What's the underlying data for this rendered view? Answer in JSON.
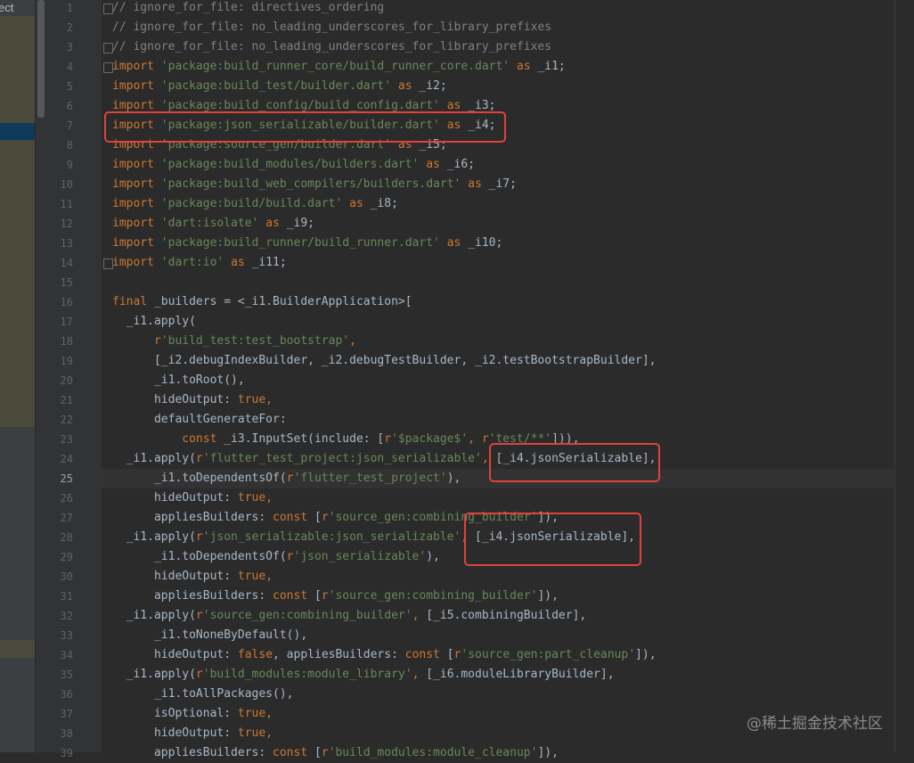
{
  "project_panel": {
    "label": "ect"
  },
  "editor": {
    "current_line": 25,
    "lines": [
      {
        "n": "1",
        "tokens": [
          {
            "t": "// ignore_for_file: directives_ordering",
            "c": "com"
          }
        ]
      },
      {
        "n": "2",
        "tokens": [
          {
            "t": "// ignore_for_file: no_leading_underscores_for_library_prefixes",
            "c": "com"
          }
        ]
      },
      {
        "n": "3",
        "tokens": [
          {
            "t": "// ignore_for_file: no_leading_underscores_for_library_prefixes",
            "c": "com"
          }
        ]
      },
      {
        "n": "4",
        "tokens": [
          {
            "t": "import ",
            "c": "kw"
          },
          {
            "t": "'package:build_runner_core/build_runner_core.dart'",
            "c": "str"
          },
          {
            "t": " as ",
            "c": "kw"
          },
          {
            "t": "_i1;",
            "c": "id"
          }
        ]
      },
      {
        "n": "5",
        "tokens": [
          {
            "t": "import ",
            "c": "kw"
          },
          {
            "t": "'package:build_test/builder.dart'",
            "c": "str"
          },
          {
            "t": " as ",
            "c": "kw"
          },
          {
            "t": "_i2;",
            "c": "id"
          }
        ]
      },
      {
        "n": "6",
        "tokens": [
          {
            "t": "import ",
            "c": "kw"
          },
          {
            "t": "'package:build_config/build_config.dart'",
            "c": "str"
          },
          {
            "t": " as ",
            "c": "kw"
          },
          {
            "t": "_i3;",
            "c": "id"
          }
        ]
      },
      {
        "n": "7",
        "tokens": [
          {
            "t": "import ",
            "c": "kw"
          },
          {
            "t": "'package:json_serializable/builder.dart'",
            "c": "str"
          },
          {
            "t": " as ",
            "c": "kw"
          },
          {
            "t": "_i4;",
            "c": "id"
          }
        ]
      },
      {
        "n": "8",
        "tokens": [
          {
            "t": "import ",
            "c": "kw"
          },
          {
            "t": "'package:source_gen/builder.dart'",
            "c": "str"
          },
          {
            "t": " as ",
            "c": "kw"
          },
          {
            "t": "_i5;",
            "c": "id"
          }
        ]
      },
      {
        "n": "9",
        "tokens": [
          {
            "t": "import ",
            "c": "kw"
          },
          {
            "t": "'package:build_modules/builders.dart'",
            "c": "str"
          },
          {
            "t": " as ",
            "c": "kw"
          },
          {
            "t": "_i6;",
            "c": "id"
          }
        ]
      },
      {
        "n": "10",
        "tokens": [
          {
            "t": "import ",
            "c": "kw"
          },
          {
            "t": "'package:build_web_compilers/builders.dart'",
            "c": "str"
          },
          {
            "t": " as ",
            "c": "kw"
          },
          {
            "t": "_i7;",
            "c": "id"
          }
        ]
      },
      {
        "n": "11",
        "tokens": [
          {
            "t": "import ",
            "c": "kw"
          },
          {
            "t": "'package:build/build.dart'",
            "c": "str"
          },
          {
            "t": " as ",
            "c": "kw"
          },
          {
            "t": "_i8;",
            "c": "id"
          }
        ]
      },
      {
        "n": "12",
        "tokens": [
          {
            "t": "import ",
            "c": "kw"
          },
          {
            "t": "'dart:isolate'",
            "c": "str"
          },
          {
            "t": " as ",
            "c": "kw"
          },
          {
            "t": "_i9;",
            "c": "id"
          }
        ]
      },
      {
        "n": "13",
        "tokens": [
          {
            "t": "import ",
            "c": "kw"
          },
          {
            "t": "'package:build_runner/build_runner.dart'",
            "c": "str"
          },
          {
            "t": " as ",
            "c": "kw"
          },
          {
            "t": "_i10;",
            "c": "id"
          }
        ]
      },
      {
        "n": "14",
        "tokens": [
          {
            "t": "import ",
            "c": "kw"
          },
          {
            "t": "'dart:io'",
            "c": "str"
          },
          {
            "t": " as ",
            "c": "kw"
          },
          {
            "t": "_i11;",
            "c": "id"
          }
        ]
      },
      {
        "n": "15",
        "tokens": []
      },
      {
        "n": "16",
        "tokens": [
          {
            "t": "final ",
            "c": "kw"
          },
          {
            "t": "_builders = <_i1.BuilderApplication>[",
            "c": "id"
          }
        ]
      },
      {
        "n": "17",
        "tokens": [
          {
            "t": "  _i1.apply(",
            "c": "id"
          }
        ]
      },
      {
        "n": "18",
        "tokens": [
          {
            "t": "      r",
            "c": "kw"
          },
          {
            "t": "'build_test:test_bootstrap'",
            "c": "str"
          },
          {
            "t": ",",
            "c": "kw"
          }
        ]
      },
      {
        "n": "19",
        "tokens": [
          {
            "t": "      [_i2.debugIndexBuilder, _i2.debugTestBuilder, _i2.testBootstrapBuilder],",
            "c": "id"
          }
        ]
      },
      {
        "n": "20",
        "tokens": [
          {
            "t": "      _i1.toRoot(),",
            "c": "id"
          }
        ]
      },
      {
        "n": "21",
        "tokens": [
          {
            "t": "      hideOutput: ",
            "c": "id"
          },
          {
            "t": "true",
            "c": "kw"
          },
          {
            "t": ",",
            "c": "kw"
          }
        ]
      },
      {
        "n": "22",
        "tokens": [
          {
            "t": "      defaultGenerateFor:",
            "c": "id"
          }
        ]
      },
      {
        "n": "23",
        "tokens": [
          {
            "t": "          const ",
            "c": "kw"
          },
          {
            "t": "_i3.InputSet(include: [",
            "c": "id"
          },
          {
            "t": "r",
            "c": "kw"
          },
          {
            "t": "'$package$'",
            "c": "str"
          },
          {
            "t": ", ",
            "c": "kw"
          },
          {
            "t": "r",
            "c": "kw"
          },
          {
            "t": "'test/**'",
            "c": "str"
          },
          {
            "t": "])),",
            "c": "id"
          }
        ]
      },
      {
        "n": "24",
        "tokens": [
          {
            "t": "  _i1.apply(",
            "c": "id"
          },
          {
            "t": "r",
            "c": "kw"
          },
          {
            "t": "'flutter_test_project:json_serializable'",
            "c": "str"
          },
          {
            "t": ", ",
            "c": "kw"
          },
          {
            "t": "[_i4.jsonSerializable],",
            "c": "id"
          }
        ]
      },
      {
        "n": "25",
        "tokens": [
          {
            "t": "      _i1.toDependentsOf(",
            "c": "id"
          },
          {
            "t": "r",
            "c": "kw"
          },
          {
            "t": "'flutter_test_project'",
            "c": "str"
          },
          {
            "t": "),",
            "c": "id"
          }
        ]
      },
      {
        "n": "26",
        "tokens": [
          {
            "t": "      hideOutput: ",
            "c": "id"
          },
          {
            "t": "true",
            "c": "kw"
          },
          {
            "t": ",",
            "c": "kw"
          }
        ]
      },
      {
        "n": "27",
        "tokens": [
          {
            "t": "      appliesBuilders: ",
            "c": "id"
          },
          {
            "t": "const ",
            "c": "kw"
          },
          {
            "t": "[",
            "c": "id"
          },
          {
            "t": "r",
            "c": "kw"
          },
          {
            "t": "'source_gen:combining_builder'",
            "c": "str"
          },
          {
            "t": "]),",
            "c": "id"
          }
        ]
      },
      {
        "n": "28",
        "tokens": [
          {
            "t": "  _i1.apply(",
            "c": "id"
          },
          {
            "t": "r",
            "c": "kw"
          },
          {
            "t": "'json_serializable:json_serializable'",
            "c": "str"
          },
          {
            "t": ", ",
            "c": "kw"
          },
          {
            "t": "[_i4.jsonSerializable],",
            "c": "id"
          }
        ]
      },
      {
        "n": "29",
        "tokens": [
          {
            "t": "      _i1.toDependentsOf(",
            "c": "id"
          },
          {
            "t": "r",
            "c": "kw"
          },
          {
            "t": "'json_serializable'",
            "c": "str"
          },
          {
            "t": "),",
            "c": "id"
          }
        ]
      },
      {
        "n": "30",
        "tokens": [
          {
            "t": "      hideOutput: ",
            "c": "id"
          },
          {
            "t": "true",
            "c": "kw"
          },
          {
            "t": ",",
            "c": "kw"
          }
        ]
      },
      {
        "n": "31",
        "tokens": [
          {
            "t": "      appliesBuilders: ",
            "c": "id"
          },
          {
            "t": "const ",
            "c": "kw"
          },
          {
            "t": "[",
            "c": "id"
          },
          {
            "t": "r",
            "c": "kw"
          },
          {
            "t": "'source_gen:combining_builder'",
            "c": "str"
          },
          {
            "t": "]),",
            "c": "id"
          }
        ]
      },
      {
        "n": "32",
        "tokens": [
          {
            "t": "  _i1.apply(",
            "c": "id"
          },
          {
            "t": "r",
            "c": "kw"
          },
          {
            "t": "'source_gen:combining_builder'",
            "c": "str"
          },
          {
            "t": ", ",
            "c": "kw"
          },
          {
            "t": "[_i5.combiningBuilder],",
            "c": "id"
          }
        ]
      },
      {
        "n": "33",
        "tokens": [
          {
            "t": "      _i1.toNoneByDefault(),",
            "c": "id"
          }
        ]
      },
      {
        "n": "34",
        "tokens": [
          {
            "t": "      hideOutput: ",
            "c": "id"
          },
          {
            "t": "false",
            "c": "kw"
          },
          {
            "t": ", appliesBuilders: ",
            "c": "id"
          },
          {
            "t": "const ",
            "c": "kw"
          },
          {
            "t": "[",
            "c": "id"
          },
          {
            "t": "r",
            "c": "kw"
          },
          {
            "t": "'source_gen:part_cleanup'",
            "c": "str"
          },
          {
            "t": "]),",
            "c": "id"
          }
        ]
      },
      {
        "n": "35",
        "tokens": [
          {
            "t": "  _i1.apply(",
            "c": "id"
          },
          {
            "t": "r",
            "c": "kw"
          },
          {
            "t": "'build_modules:module_library'",
            "c": "str"
          },
          {
            "t": ", ",
            "c": "kw"
          },
          {
            "t": "[_i6.moduleLibraryBuilder],",
            "c": "id"
          }
        ]
      },
      {
        "n": "36",
        "tokens": [
          {
            "t": "      _i1.toAllPackages(),",
            "c": "id"
          }
        ]
      },
      {
        "n": "37",
        "tokens": [
          {
            "t": "      isOptional: ",
            "c": "id"
          },
          {
            "t": "true",
            "c": "kw"
          },
          {
            "t": ",",
            "c": "kw"
          }
        ]
      },
      {
        "n": "38",
        "tokens": [
          {
            "t": "      hideOutput: ",
            "c": "id"
          },
          {
            "t": "true",
            "c": "kw"
          },
          {
            "t": ",",
            "c": "kw"
          }
        ]
      },
      {
        "n": "39",
        "tokens": [
          {
            "t": "      appliesBuilders: ",
            "c": "id"
          },
          {
            "t": "const ",
            "c": "kw"
          },
          {
            "t": "[",
            "c": "id"
          },
          {
            "t": "r",
            "c": "kw"
          },
          {
            "t": "'build_modules:module_cleanup'",
            "c": "str"
          },
          {
            "t": "]),",
            "c": "id"
          }
        ]
      }
    ]
  },
  "annotations": {
    "highlight_color": "#e0423c",
    "highlights": [
      "line-7-import-json-serializable",
      "line-24-i4-jsonSerializable",
      "line-28-i4-jsonSerializable"
    ]
  },
  "watermark": "@稀土掘金技术社区"
}
